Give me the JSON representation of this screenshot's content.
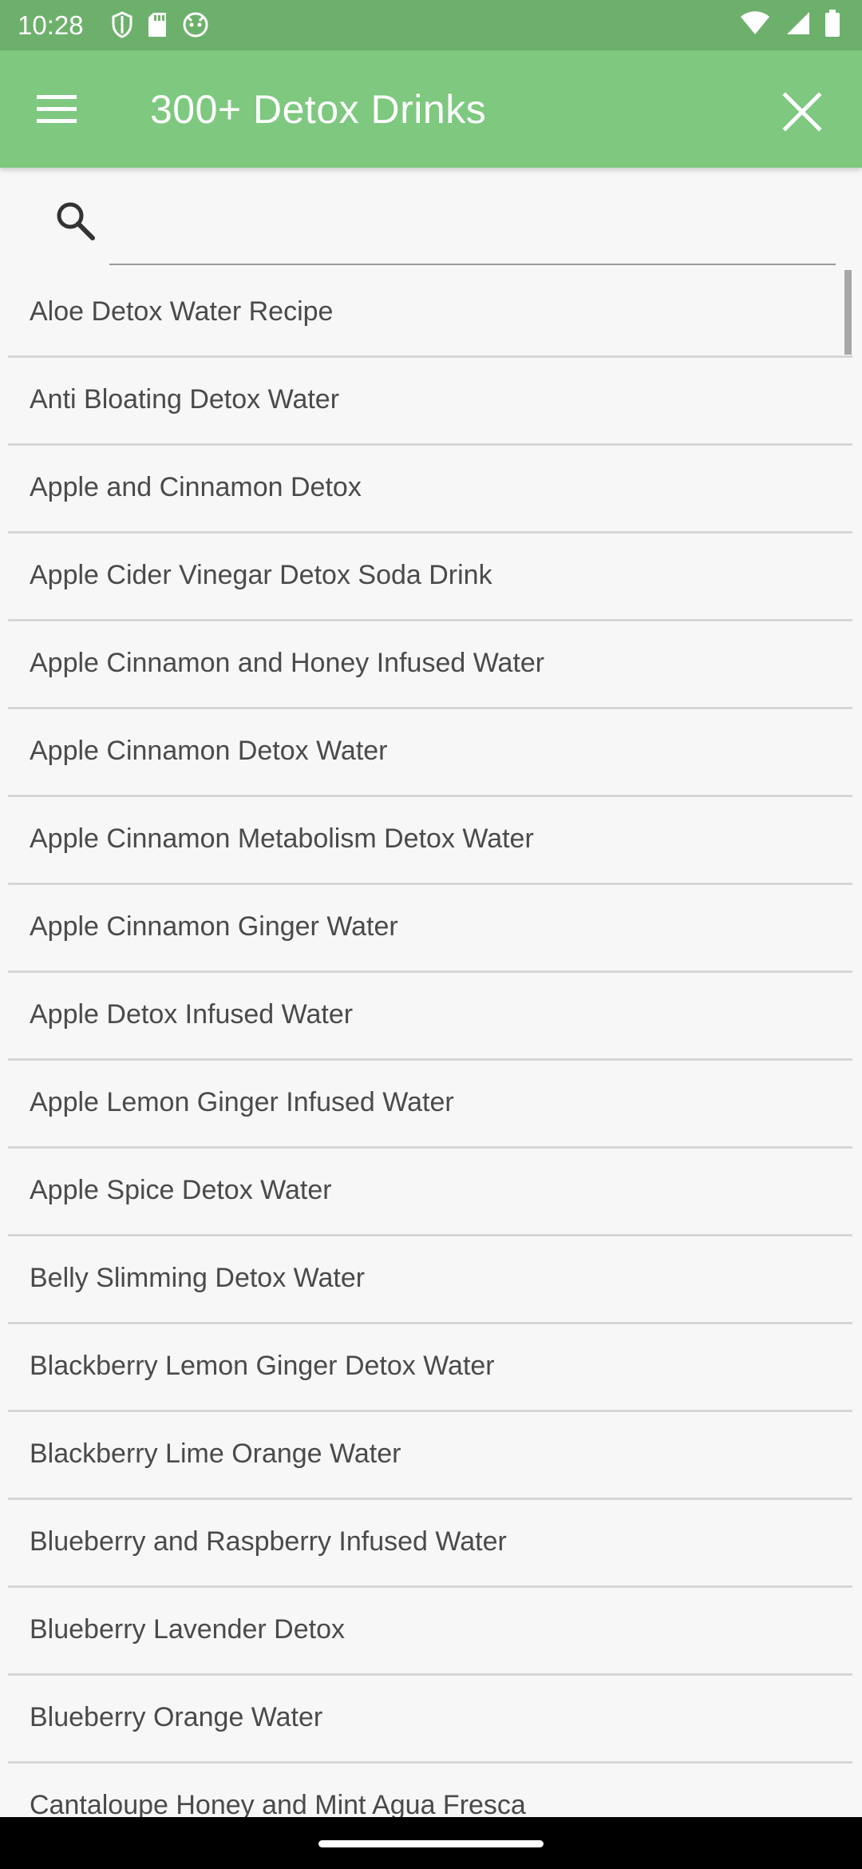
{
  "status_bar": {
    "time": "10:28",
    "left_icons": [
      "shield-icon",
      "sd-card-icon",
      "android-icon"
    ],
    "right_icons": [
      "wifi-icon",
      "signal-icon",
      "battery-icon"
    ]
  },
  "app_bar": {
    "title": "300+ Detox Drinks",
    "menu_icon": "menu-icon",
    "close_icon": "close-icon",
    "background": "#7ec880"
  },
  "search": {
    "value": "",
    "placeholder": ""
  },
  "recipes": [
    "Aloe Detox Water Recipe",
    "Anti Bloating Detox Water",
    "Apple and Cinnamon Detox",
    "Apple Cider Vinegar Detox Soda Drink",
    "Apple Cinnamon and Honey Infused Water",
    "Apple Cinnamon Detox Water",
    "Apple Cinnamon Metabolism Detox Water",
    "Apple Cinnamon Ginger Water",
    "Apple Detox Infused Water",
    "Apple Lemon Ginger Infused Water",
    "Apple Spice Detox Water",
    "Belly Slimming Detox Water",
    "Blackberry Lemon Ginger Detox Water",
    "Blackberry Lime Orange Water",
    "Blueberry and Raspberry Infused Water",
    "Blueberry Lavender Detox",
    "Blueberry Orange Water",
    "Cantaloupe Honey and Mint Agua Fresca"
  ]
}
